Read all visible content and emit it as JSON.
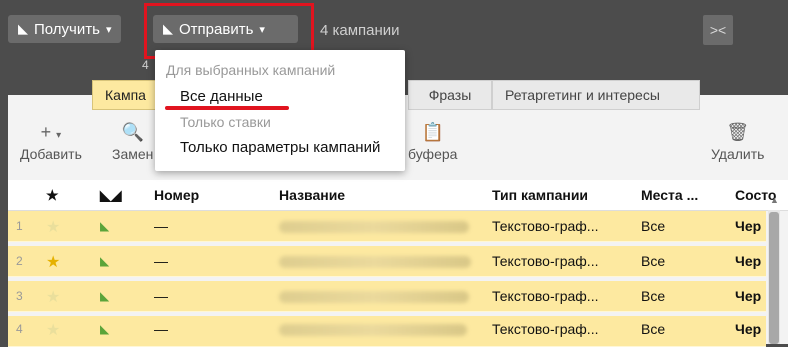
{
  "topbar": {
    "get_label": "Получить",
    "send_label": "Отправить",
    "campaign_count": "4 кампании",
    "small_count": "4"
  },
  "tabs": [
    "Кампа",
    "Фразы",
    "Ретаргетинг и интересы"
  ],
  "toolbar": {
    "add": "Добавить",
    "replace": "Замен",
    "clipboard": "буфера",
    "delete": "Удалить"
  },
  "table": {
    "headers": [
      "Номер",
      "Название",
      "Тип кампании",
      "Места ...",
      "Состо"
    ],
    "rows": [
      {
        "num": "1",
        "number": "—",
        "type": "Текстово-граф...",
        "places": "Все",
        "status": "Чер"
      },
      {
        "num": "2",
        "number": "—",
        "type": "Текстово-граф...",
        "places": "Все",
        "status": "Чер"
      },
      {
        "num": "3",
        "number": "—",
        "type": "Текстово-граф...",
        "places": "Все",
        "status": "Чер"
      },
      {
        "num": "4",
        "number": "—",
        "type": "Текстово-граф...",
        "places": "Все",
        "status": "Чер"
      }
    ]
  },
  "dropdown": {
    "header": "Для выбранных кампаний",
    "items": [
      "Все данные",
      "Только ставки",
      "Только параметры кампаний"
    ]
  },
  "colors": {
    "highlight": "#e1141f",
    "row_bg": "#fde9a0",
    "active_tab": "#fde9a0"
  }
}
